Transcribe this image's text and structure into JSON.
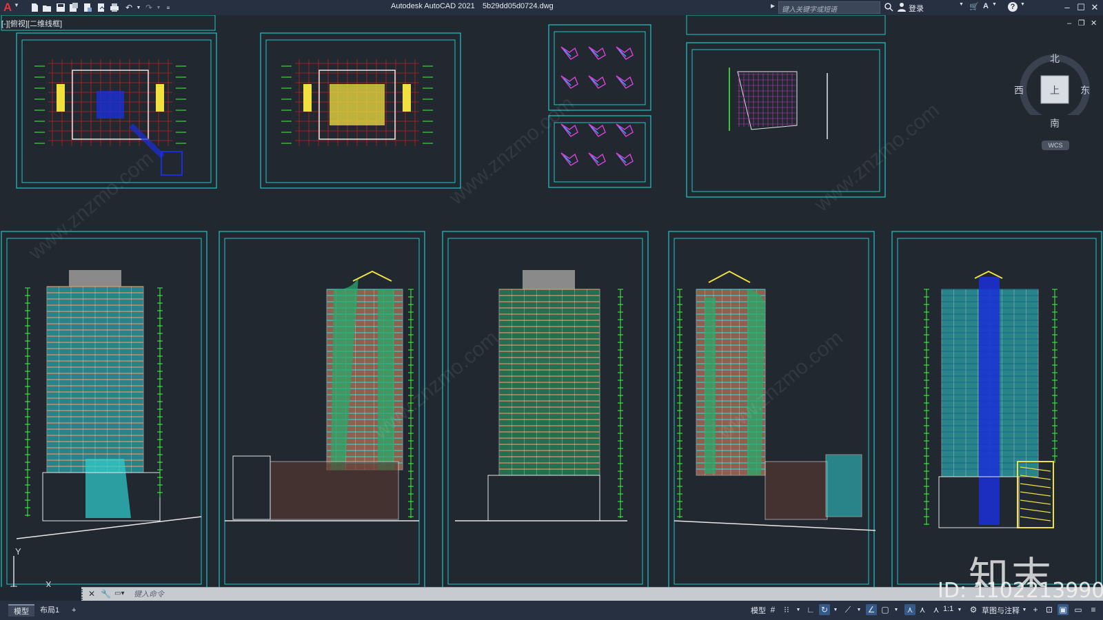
{
  "app": {
    "title": "Autodesk AutoCAD 2021",
    "file_name": "5b29dd05d0724.dwg"
  },
  "titlebar": {
    "search_placeholder": "键入关键字或短语",
    "sign_in": "登录",
    "help": "?"
  },
  "viewport": {
    "label": "[-][俯视][二维线框]"
  },
  "viewcube": {
    "north": "北",
    "south": "南",
    "east": "东",
    "west": "西",
    "face": "上",
    "wcs": "WCS"
  },
  "ucs": {
    "y_label": "Y",
    "x_label": "X"
  },
  "command": {
    "placeholder": "键入命令"
  },
  "layout_tabs": [
    {
      "label": "模型",
      "active": true
    },
    {
      "label": "布局1",
      "active": false
    },
    {
      "label": "+",
      "active": false
    }
  ],
  "statusbar": {
    "model_label": "模型",
    "scale": "1:1",
    "workspace": "草图与注释"
  },
  "watermark": {
    "brand": "知末",
    "id": "ID: 1102213990",
    "site": "www.znzmo.com"
  },
  "colors": {
    "background": "#212830",
    "sheet_border": "#1fc8c8",
    "building_cyan": "#2fd0d0",
    "building_green": "#2aa86a",
    "building_orange": "#e8906a",
    "dimension_green": "#3cff3c",
    "annotation_yellow": "#f0e040",
    "accent_blue": "#1a2fd8"
  }
}
